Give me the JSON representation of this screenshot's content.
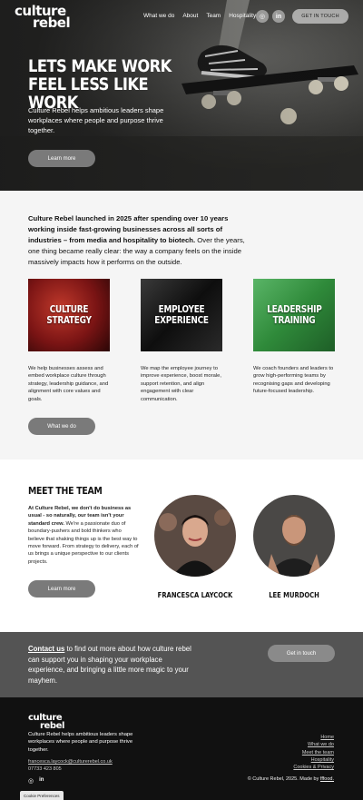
{
  "header": {
    "logo_line1": "culture",
    "logo_line2": "rebel",
    "nav": [
      "What we do",
      "About",
      "Team",
      "Hospitality"
    ],
    "social_icons": [
      "instagram-icon",
      "linkedin-icon"
    ],
    "cta": "GET IN TOUCH"
  },
  "hero": {
    "title": "LETS MAKE WORK FEEL LESS LIKE WORK",
    "subtitle": "Culture Rebel helps ambitious leaders shape workplaces where people and purpose thrive together.",
    "button": "Learn more"
  },
  "intro": {
    "bold": "Culture Rebel launched in 2025 after spending over 10 years working inside fast-growing businesses across all sorts of industries – from media and hospitality to biotech.",
    "rest": " Over the years, one thing became really clear: the way a company feels on the inside massively impacts how it performs on the outside."
  },
  "services": [
    {
      "title": "CULTURE STRATEGY",
      "text": "We help businesses assess and embed workplace culture through strategy, leadership guidance, and alignment with core values and goals.",
      "color": "#7a1414"
    },
    {
      "title": "EMPLOYEE EXPERIENCE",
      "text": "We map the employee journey to improve experience, boost morale, support retention, and align engagement with clear communication.",
      "color": "#1c1c1c"
    },
    {
      "title": "LEADERSHIP TRAINING",
      "text": "We coach founders and leaders to grow high-performing teams by recognising gaps and developing future-focused leadership.",
      "color": "#2f8a3a"
    }
  ],
  "services_button": "What we do",
  "team": {
    "heading": "MEET THE TEAM",
    "bold": "At Culture Rebel, we don't do business as usual - so naturally, our team isn't your standard crew.",
    "rest": " We're a passionate duo of boundary-pushers and bold thinkers who believe that shaking things up is the best way to move forward. From strategy to delivery, each of us brings a unique perspective to our clients projects.",
    "button": "Learn more",
    "members": [
      "FRANCESCA LAYCOCK",
      "LEE MURDOCH"
    ]
  },
  "contact": {
    "link": "Contact us",
    "text": " to find out more about how culture rebel can support you in shaping your workplace experience, and bringing a little more magic to your mayhem.",
    "button": "Get in touch"
  },
  "footer": {
    "logo_line1": "culture",
    "logo_line2": "rebel",
    "tagline": "Culture Rebel helps ambitious leaders shape workplaces where people and purpose thrive together.",
    "email": "francesca.laycock@culturerebel.co.uk",
    "phone": "07733 423 805",
    "links": [
      "Home",
      "What we do",
      "Meet the team",
      "Hospitality",
      "Cookies & Privacy"
    ],
    "copyright": "© Culture Rebel, 2025. Made by ",
    "maker": "fffood."
  },
  "cookie_button": "Cookie Preferences"
}
